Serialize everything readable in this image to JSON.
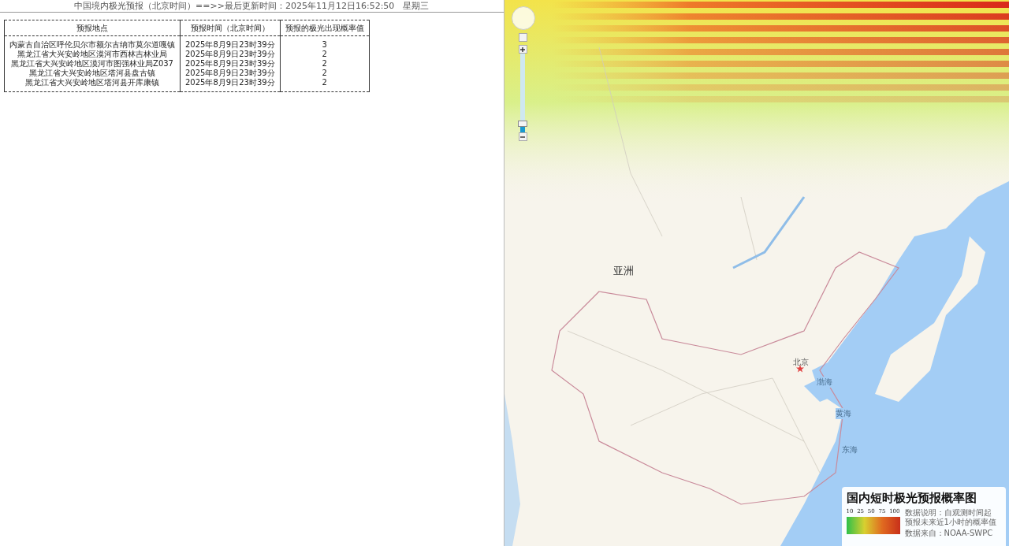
{
  "header": {
    "title": "中国境内极光预报（北京时间）==>>最后更新时间：2025年11月12日16:52:50　星期三"
  },
  "table": {
    "columns": [
      "预报地点",
      "预报时间（北京时间）",
      "预报的极光出现概率值"
    ],
    "rows": [
      [
        "内蒙古自治区呼伦贝尔市额尔古纳市莫尔道嘎镇",
        "2025年8月9日23时39分",
        "3"
      ],
      [
        "黑龙江省大兴安岭地区漠河市西林吉林业局",
        "2025年8月9日23时39分",
        "2"
      ],
      [
        "黑龙江省大兴安岭地区漠河市图强林业局Z037",
        "2025年8月9日23时39分",
        "2"
      ],
      [
        "黑龙江省大兴安岭地区塔河县盘古镇",
        "2025年8月9日23时39分",
        "2"
      ],
      [
        "黑龙江省大兴安岭地区塔河县开库康镇",
        "2025年8月9日23时39分",
        "2"
      ]
    ]
  },
  "map": {
    "zoom_slider": {
      "level": 0.12
    },
    "labels": [
      {
        "text": "亚洲",
        "kind": "continent"
      },
      {
        "text": "北京",
        "kind": "city"
      },
      {
        "text": "渤海",
        "kind": "sea"
      },
      {
        "text": "黄海",
        "kind": "sea"
      },
      {
        "text": "东海",
        "kind": "sea"
      }
    ],
    "legend": {
      "title": "国内短时极光预报概率图",
      "scale": [
        "10",
        "25",
        "50",
        "75",
        "100"
      ],
      "note": [
        "数据说明：自观测时间起",
        "预报未来近1小时的概率值"
      ],
      "source": "数据来自：NOAA-SWPC"
    }
  }
}
